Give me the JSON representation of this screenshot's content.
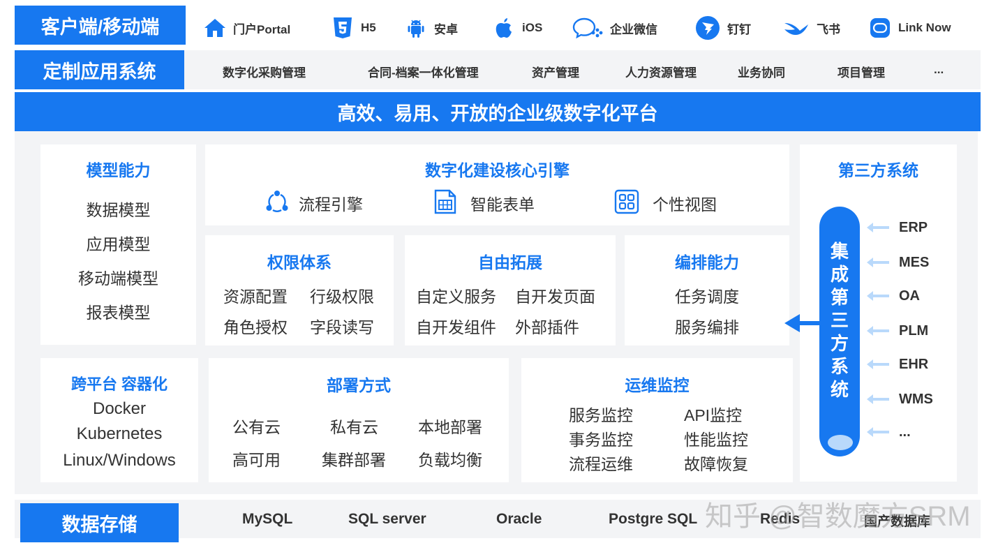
{
  "client": {
    "label": "客户端/移动端",
    "items": [
      {
        "icon": "home-icon",
        "label": "门户Portal"
      },
      {
        "icon": "html5-icon",
        "label": "H5"
      },
      {
        "icon": "android-icon",
        "label": "安卓"
      },
      {
        "icon": "apple-icon",
        "label": "iOS"
      },
      {
        "icon": "wecom-icon",
        "label": "企业微信"
      },
      {
        "icon": "dingtalk-icon",
        "label": "钉钉"
      },
      {
        "icon": "feishu-icon",
        "label": "飞书"
      },
      {
        "icon": "linknow-icon",
        "label": "Link Now"
      }
    ]
  },
  "apps": {
    "label": "定制应用系统",
    "items": [
      "数字化采购管理",
      "合同-档案一体化管理",
      "资产管理",
      "人力资源管理",
      "业务协同",
      "项目管理",
      "..."
    ]
  },
  "platform": {
    "title": "高效、易用、开放的企业级数字化平台"
  },
  "model": {
    "title": "模型能力",
    "items": [
      "数据模型",
      "应用模型",
      "移动端模型",
      "报表模型"
    ]
  },
  "engine": {
    "title": "数字化建设核心引擎",
    "items": [
      {
        "icon": "process-cycle-icon",
        "label": "流程引擎"
      },
      {
        "icon": "form-icon",
        "label": "智能表单"
      },
      {
        "icon": "grid-view-icon",
        "label": "个性视图"
      }
    ]
  },
  "permission": {
    "title": "权限体系",
    "items": [
      "资源配置",
      "行级权限",
      "角色授权",
      "字段读写"
    ]
  },
  "extend": {
    "title": "自由拓展",
    "items": [
      "自定义服务",
      "自开发页面",
      "自开发组件",
      "外部插件"
    ]
  },
  "orchestrate": {
    "title": "编排能力",
    "items": [
      "任务调度",
      "服务编排"
    ]
  },
  "third_party": {
    "title": "第三方系统",
    "integration_label": "集成第三方系统",
    "systems": [
      "ERP",
      "MES",
      "OA",
      "PLM",
      "EHR",
      "WMS",
      "..."
    ]
  },
  "container": {
    "title": "跨平台 容器化",
    "items": [
      "Docker",
      "Kubernetes",
      "Linux/Windows"
    ]
  },
  "deploy": {
    "title": "部署方式",
    "items": [
      "公有云",
      "私有云",
      "本地部署",
      "高可用",
      "集群部署",
      "负载均衡"
    ]
  },
  "ops": {
    "title": "运维监控",
    "items": [
      "服务监控",
      "API监控",
      "事务监控",
      "性能监控",
      "流程运维",
      "故障恢复"
    ]
  },
  "storage": {
    "label": "数据存储",
    "items": [
      "MySQL",
      "SQL server",
      "Oracle",
      "Postgre SQL",
      "Redis",
      "国产数据库"
    ]
  },
  "watermark": "知乎 @智数魔方SRM",
  "colors": {
    "accent": "#1778f0",
    "panel_bg": "#f3f4f6",
    "arrow_light": "#b9d9fb"
  }
}
